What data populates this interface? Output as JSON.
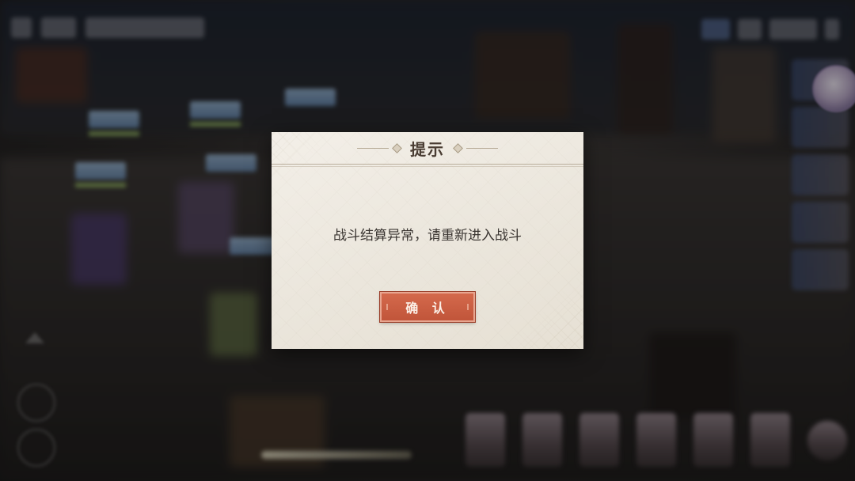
{
  "dialog": {
    "title": "提示",
    "message": "战斗结算异常，请重新进入战斗",
    "confirm_label": "确 认"
  },
  "colors": {
    "dialog_bg": "#efebe3",
    "confirm_button": "#c9603f",
    "title_text": "#4a3d33"
  },
  "icons": {
    "title_ornament": "diamond-ornament-icon"
  }
}
